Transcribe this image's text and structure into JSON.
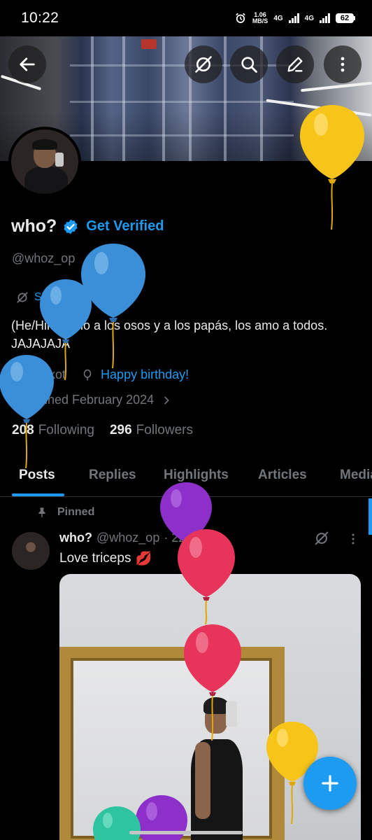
{
  "status_bar": {
    "time": "10:22",
    "net_speed_value": "1.06",
    "net_speed_unit": "MB/S",
    "network_1": "4G",
    "network_2": "4G",
    "battery": "62"
  },
  "profile": {
    "name": "who?",
    "get_verified_label": "Get Verified",
    "handle": "@whoz_op",
    "show_translation_label": "Show translation",
    "bio": "(He/Him) Amo a los osos y a los papás, los amo a todos. JAJAJAJA",
    "location": "7e kot",
    "birthday_label": "Happy birthday!",
    "joined": "Joined February 2024",
    "following_count": "208",
    "following_label": "Following",
    "followers_count": "296",
    "followers_label": "Followers"
  },
  "tabs": [
    {
      "label": "Posts",
      "active": true
    },
    {
      "label": "Replies",
      "active": false
    },
    {
      "label": "Highlights",
      "active": false
    },
    {
      "label": "Articles",
      "active": false
    },
    {
      "label": "Media",
      "active": false
    }
  ],
  "pinned_post": {
    "pinned_label": "Pinned",
    "author_name": "who?",
    "author_handle": "@whoz_op",
    "date": "· 22 Jul 24",
    "text": "Love triceps",
    "emoji": "💋"
  },
  "colors": {
    "accent": "#1d9bf0",
    "background": "#000000",
    "text_primary": "#e7e9ea",
    "text_secondary": "#71767b"
  },
  "icons": {
    "back": "arrow-left-icon",
    "translate": "translate-off-icon",
    "search": "search-icon",
    "edit": "pen-icon",
    "more": "more-vertical-icon",
    "location": "location-pin-icon",
    "birthday": "balloon-icon",
    "calendar": "calendar-icon",
    "pin": "pin-icon",
    "compose": "plus-icon"
  }
}
